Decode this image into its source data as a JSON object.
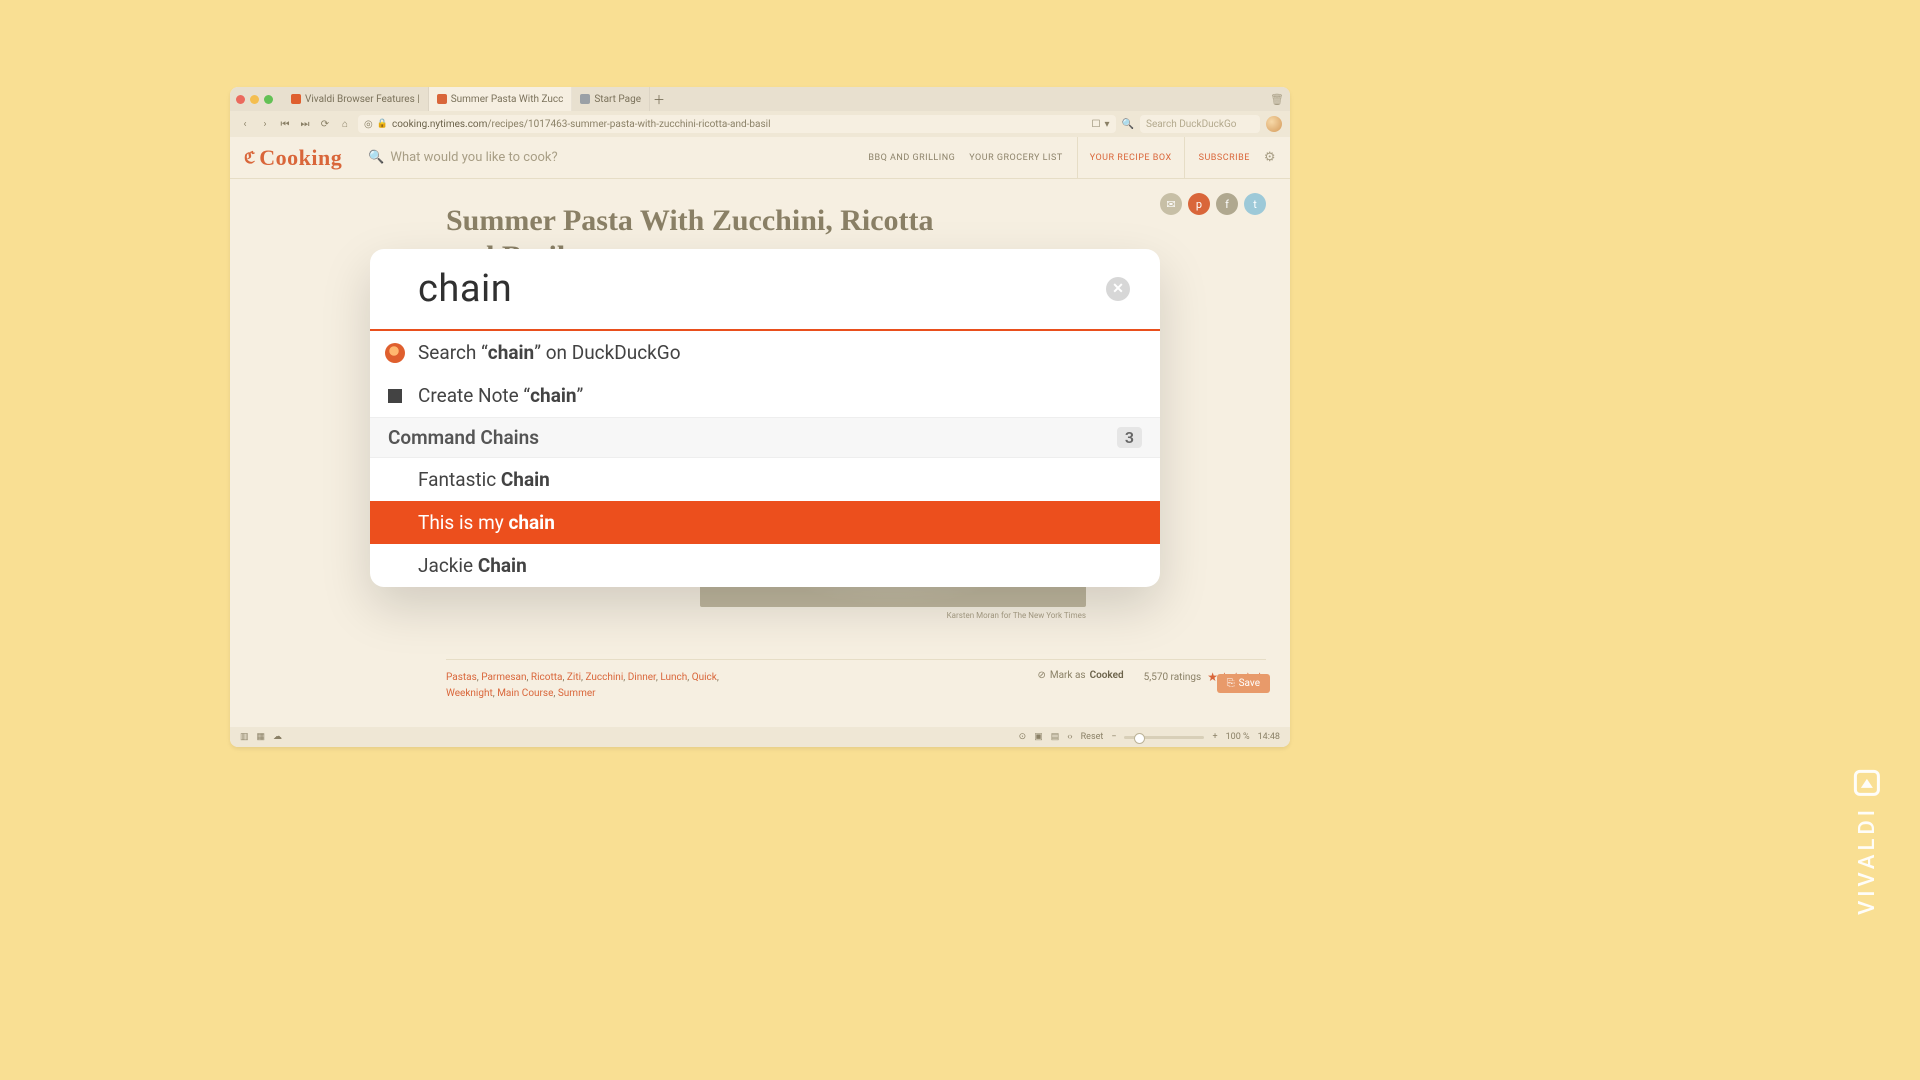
{
  "browser": {
    "tabs": [
      {
        "label": "Vivaldi Browser Features |",
        "favicon": "#df5f2e",
        "active": false
      },
      {
        "label": "Summer Pasta With Zucc",
        "favicon": "#d9663a",
        "active": true
      },
      {
        "label": "Start Page",
        "favicon": "#9aa0a6",
        "active": false
      }
    ],
    "url_host": "cooking.nytimes.com",
    "url_path": "/recipes/1017463-summer-pasta-with-zucchini-ricotta-and-basil",
    "search_placeholder": "Search DuckDuckGo"
  },
  "page": {
    "brand_t": "ℭ",
    "brand_name": "Cooking",
    "search_placeholder": "What would you like to cook?",
    "nav": {
      "bbq": "BBQ AND GRILLING",
      "grocery": "YOUR GROCERY LIST",
      "recipebox": "YOUR RECIPE BOX",
      "subscribe": "SUBSCRIBE"
    },
    "article_title": "Summer Pasta With Zucchini, Ricotta and Basil",
    "hero_caption": "Karsten Moran for The New York Times",
    "tags": [
      "Pastas",
      "Parmesan",
      "Ricotta",
      "Ziti",
      "Zucchini",
      "Dinner",
      "Lunch",
      "Quick",
      "Weeknight",
      "Main Course",
      "Summer"
    ],
    "mark_label": "Mark as",
    "mark_bold": "Cooked",
    "ratings_count": "5,570 ratings",
    "save_label": "Save"
  },
  "statusbar": {
    "reset": "Reset",
    "zoom": "100 %",
    "time": "14:48"
  },
  "qc": {
    "query": "chain",
    "search_pre": "Search “",
    "search_bold": "chain",
    "search_post": "” on DuckDuckGo",
    "note_pre": "Create Note “",
    "note_bold": "chain",
    "note_post": "”",
    "section_label": "Command Chains",
    "section_count": "3",
    "results": [
      {
        "pre": "Fantastic ",
        "bold": "Chain",
        "post": "",
        "selected": false
      },
      {
        "pre": "This is my ",
        "bold": "chain",
        "post": "",
        "selected": true
      },
      {
        "pre": "Jackie ",
        "bold": "Chain",
        "post": "",
        "selected": false
      }
    ]
  },
  "watermark": "VIVALDI"
}
